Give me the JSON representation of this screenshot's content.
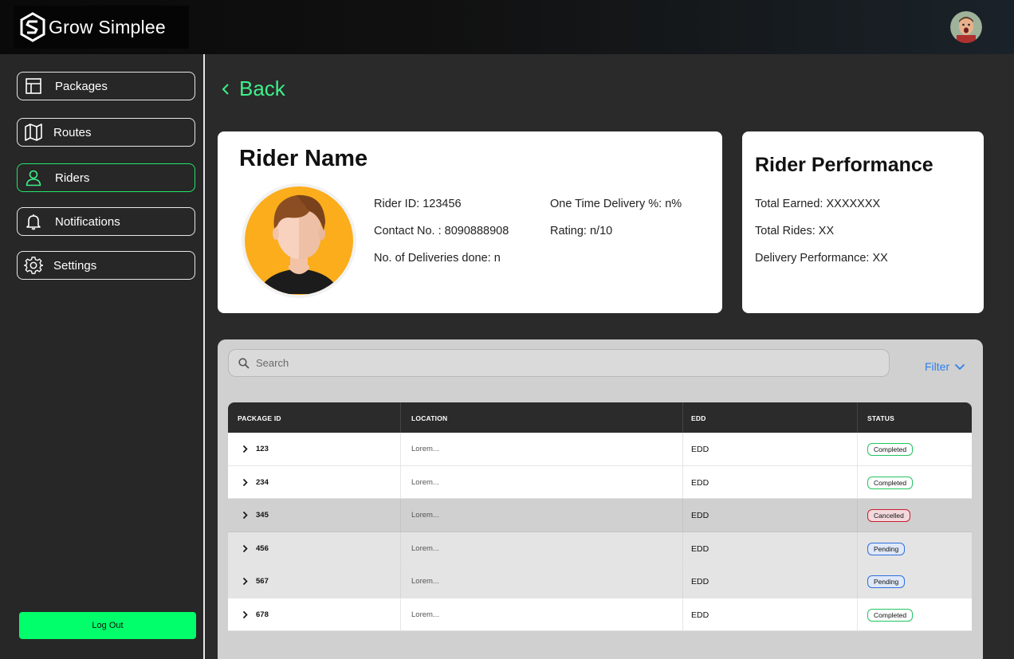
{
  "app": {
    "brand": "Grow Simplee"
  },
  "sidebar": {
    "items": [
      {
        "label": "Packages",
        "icon": "layout-icon",
        "active": false
      },
      {
        "label": "Routes",
        "icon": "map-icon",
        "active": false
      },
      {
        "label": "Riders",
        "icon": "user-icon",
        "active": true
      },
      {
        "label": "Notifications",
        "icon": "bell-icon",
        "active": false
      },
      {
        "label": "Settings",
        "icon": "gear-icon",
        "active": false
      }
    ],
    "logout_label": "Log Out"
  },
  "back_label": "Back",
  "rider": {
    "title": "Rider Name",
    "id": "Rider ID: 123456",
    "contact": "Contact No. : 8090888908",
    "deliveries": "No. of Deliveries done: n",
    "on_time": "One Time Delivery %: n%",
    "rating": "Rating: n/10"
  },
  "performance": {
    "title": "Rider Performance",
    "total_earned": "Total Earned: XXXXXXX",
    "total_rides": "Total Rides: XX",
    "delivery_performance": "Delivery Performance: XX"
  },
  "search": {
    "placeholder": "Search"
  },
  "filter_label": "Filter",
  "table": {
    "headers": [
      "PACKAGE ID",
      "LOCATION",
      "EDD",
      "STATUS"
    ],
    "rows": [
      {
        "id": "123",
        "location": "Lorem...",
        "edd": "EDD",
        "status": "Completed"
      },
      {
        "id": "234",
        "location": "Lorem...",
        "edd": "EDD",
        "status": "Completed"
      },
      {
        "id": "345",
        "location": "Lorem...",
        "edd": "EDD",
        "status": "Cancelled"
      },
      {
        "id": "456",
        "location": "Lorem...",
        "edd": "EDD",
        "status": "Pending"
      },
      {
        "id": "567",
        "location": "Lorem...",
        "edd": "EDD",
        "status": "Pending"
      },
      {
        "id": "678",
        "location": "Lorem...",
        "edd": "EDD",
        "status": "Completed"
      }
    ]
  },
  "colors": {
    "accent_green": "#3ef08a",
    "completed": "#22c55e",
    "cancelled": "#c81e32",
    "pending": "#2f6fe0",
    "row_white": "#ffffff",
    "row_gray": "#cfd0cf",
    "row_light": "#e4e4e4"
  }
}
